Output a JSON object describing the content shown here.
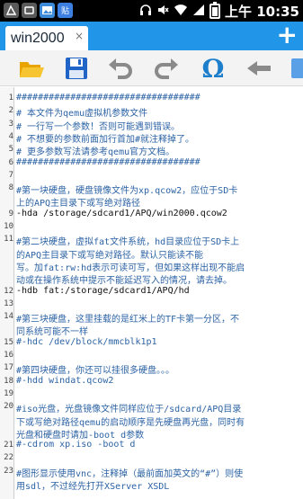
{
  "statusbar": {
    "icons": [
      "usb-debug-icon",
      "notification-icon",
      "gallery-icon",
      "app-icon"
    ],
    "app_icon_text": "贴",
    "time": "上午 10:35",
    "right_icons": [
      "headphones-icon",
      "mute-icon",
      "wifi-icon",
      "signal-icon",
      "battery-icon"
    ]
  },
  "tabs": [
    {
      "label": "win2000",
      "close": "×"
    }
  ],
  "add_tab": "+",
  "toolbar": {
    "buttons": [
      "open-folder-icon",
      "save-icon",
      "undo-icon",
      "redo-icon",
      "special-chars-icon",
      "back-arrow-icon"
    ],
    "omega": "Ω"
  },
  "editor": {
    "line_numbers": [
      "1",
      "2",
      "3",
      "4",
      "5",
      "6",
      "7",
      "8",
      "9",
      "10",
      "11",
      "12",
      "13",
      "14",
      "15",
      "16",
      "17",
      "18",
      "19",
      "20",
      "21",
      "22",
      "23"
    ],
    "lines": [
      {
        "text": "##################################",
        "type": "comment"
      },
      {
        "text": "#     本文件为qemu虚拟机参数文件",
        "type": "comment"
      },
      {
        "text": "#     一行写一个参数！否则可能遇到错误。",
        "type": "comment"
      },
      {
        "text": "#     不想要的参数前面加行首加#就注释掉了。",
        "type": "comment"
      },
      {
        "text": "#     更多参数写法请参考qemu官方文档。",
        "type": "comment"
      },
      {
        "text": "##################################",
        "type": "comment"
      },
      {
        "text": "",
        "type": "code"
      },
      {
        "text": "#第一块硬盘，硬盘镜像文件为xp.qcow2，应位于SD卡",
        "type": "comment"
      },
      {
        "text": "上的APQ主目录下或写绝对路径",
        "type": "comment"
      },
      {
        "text": "-hda /storage/sdcard1/APQ/win2000.qcow2",
        "type": "code"
      },
      {
        "text": "",
        "type": "code"
      },
      {
        "text": "#第二块硬盘，虚拟fat文件系统，hd目录应位于SD卡上",
        "type": "comment"
      },
      {
        "text": "的APQ主目录下或写绝对路径。默认只能读不能",
        "type": "comment"
      },
      {
        "text": "写。加fat:rw:hd表示可读可写，但如果这样出现不能启",
        "type": "comment"
      },
      {
        "text": "动或在操作系统中提示不能延迟写入的情况，请去掉。",
        "type": "comment"
      },
      {
        "text": "-hdb fat:/storage/sdcard1/APQ/hd",
        "type": "code"
      },
      {
        "text": "",
        "type": "code"
      },
      {
        "text": "#第三块硬盘，这里挂载的是红米上的TF卡第一分区，不",
        "type": "comment"
      },
      {
        "text": "同系统可能不一样",
        "type": "comment"
      },
      {
        "text": "#-hdc /dev/block/mmcblk1p1",
        "type": "comment"
      },
      {
        "text": "",
        "type": "code"
      },
      {
        "text": "#第四块硬盘，你还可以挂很多硬盘。。。",
        "type": "comment"
      },
      {
        "text": "#-hdd windat.qcow2",
        "type": "comment"
      },
      {
        "text": "",
        "type": "code"
      },
      {
        "text": "#iso光盘，光盘镜像文件同样应位于/sdcard/APQ目录",
        "type": "comment"
      },
      {
        "text": "下或写绝对路径qemu的启动顺序是先硬盘再光盘，同时有",
        "type": "comment"
      },
      {
        "text": "光盘和硬盘时请加-boot d参数",
        "type": "comment"
      },
      {
        "text": "#-cdrom xp.iso -boot d",
        "type": "comment"
      },
      {
        "text": "",
        "type": "code"
      },
      {
        "text": "#图形显示使用vnc，注释掉（最前面加英文的“#”）则使",
        "type": "comment"
      },
      {
        "text": "用sdl，不过经先打开XServer XSDL",
        "type": "comment"
      }
    ]
  },
  "colors": {
    "tabbar": "#2196e8",
    "comment": "#2c63a5",
    "code": "#111111",
    "statusbar": "#000000"
  }
}
